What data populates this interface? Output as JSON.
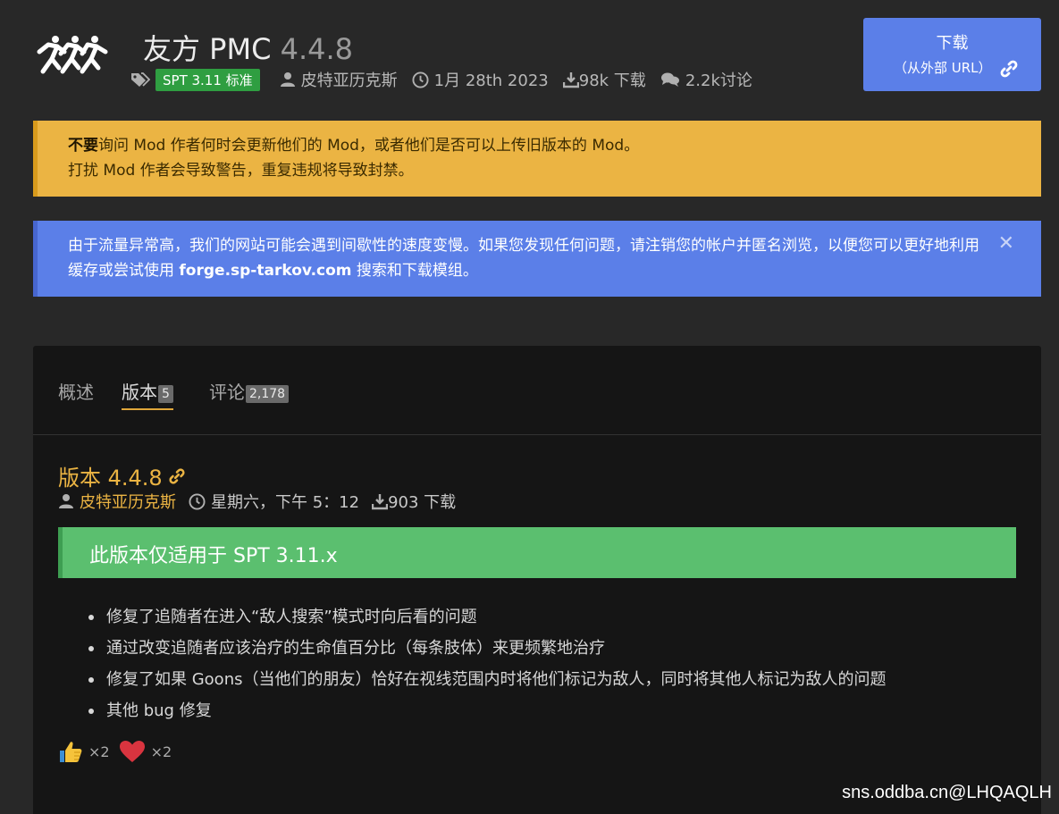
{
  "header": {
    "mod_name": "友方 PMC",
    "mod_version": "4.4.8",
    "spt_badge": "SPT 3.11 标准",
    "author": "皮特亚历克斯",
    "date": "1月 28th 2023",
    "downloads": "98k 下载",
    "comments": "2.2k讨论"
  },
  "download_button": {
    "line1": "下载",
    "line2": "（从外部 URL）"
  },
  "alerts": {
    "warning_bold": "不要",
    "warning_line1_rest": "询问 Mod 作者何时会更新他们的 Mod，或者他们是否可以上传旧版本的 Mod。",
    "warning_line2": "打扰 Mod 作者会导致警告，重复违规将导致封禁。",
    "info_text_before": "由于流量异常高，我们的网站可能会遇到间歇性的速度变慢。如果您发现任何问题，请注销您的帐户并匿名浏览，以便您可以更好地利用缓存或尝试使用 ",
    "info_highlight": "forge.sp-tarkov.com",
    "info_text_after": " 搜索和下载模组。",
    "close_glyph": "✕"
  },
  "tabs": [
    {
      "label": "概述",
      "count": ""
    },
    {
      "label": "版本",
      "count": "5"
    },
    {
      "label": "评论",
      "count": "2,178"
    }
  ],
  "version": {
    "title": "版本 4.4.8",
    "author": "皮特亚历克斯",
    "time": "星期六，下午 5：12",
    "downloads": "903 下载",
    "compat_notice": "此版本仅适用于 SPT 3.11.x",
    "changes": [
      "修复了追随者在进入“敌人搜索”模式时向后看的问题",
      "通过改变追随者应该治疗的生命值百分比（每条肢体）来更频繁地治疗",
      "修复了如果 Goons（当他们的朋友）恰好在视线范围内时将他们标记为敌人，同时将其他人标记为敌人的问题",
      "其他 bug 修复"
    ]
  },
  "reactions": [
    {
      "icon": "thumbs-up-icon",
      "count": "×2"
    },
    {
      "icon": "heart-icon",
      "count": "×2"
    }
  ],
  "watermark": "sns.oddba.cn@LHQAQLH",
  "colors": {
    "accent_yellow": "#ebb443",
    "accent_blue": "#5b7fe8",
    "accent_green": "#5bbf6f",
    "badge_green": "#2f9e41"
  }
}
